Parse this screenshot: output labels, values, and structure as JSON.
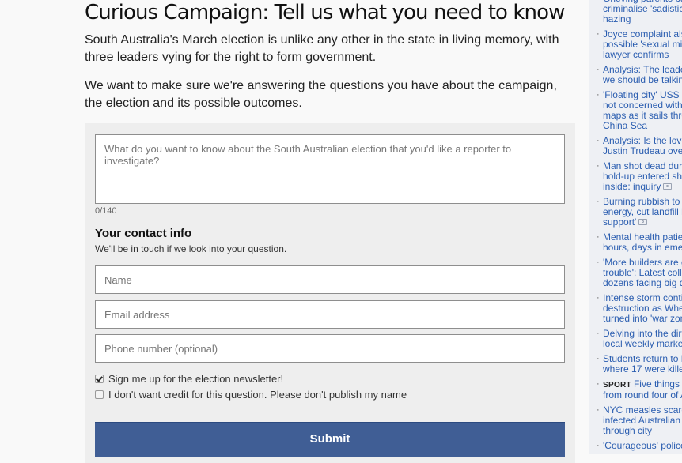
{
  "article": {
    "title": "Curious Campaign: Tell us what you need to know",
    "paragraphs": [
      "South Australia's March election is unlike any other in the state in living memory, with three leaders vying for the right to form government.",
      "We want to make sure we're answering the questions you have about the campaign, the election and its possible outcomes."
    ]
  },
  "form": {
    "question_placeholder": "What do you want to know about the South Australian election that you'd like a reporter to investigate?",
    "question_value": "",
    "char_counter": "0/140",
    "contact_title": "Your contact info",
    "contact_subtitle": "We'll be in touch if we look into your question.",
    "name_placeholder": "Name",
    "email_placeholder": "Email address",
    "phone_placeholder": "Phone number (optional)",
    "newsletter_label": "Sign me up for the election newsletter!",
    "newsletter_checked": true,
    "anonymous_label": "I don't want credit for this question. Please don't publish my name",
    "anonymous_checked": false,
    "submit_label": "Submit",
    "submit_color": "#405e95"
  },
  "sidebar": {
    "link_color": "#2a5db0",
    "items": [
      {
        "lines": [
          "Grieving parents back",
          "criminalise 'sadistic'",
          "hazing"
        ],
        "tag": "",
        "camera": false
      },
      {
        "lines": [
          "Joyce complaint also",
          "possible 'sexual mis",
          "lawyer confirms"
        ],
        "tag": "",
        "camera": false
      },
      {
        "lines": [
          "Analysis: The leade",
          "we should be talking"
        ],
        "tag": "",
        "camera": false
      },
      {
        "lines": [
          "'Floating city' USS C",
          "not concerned with",
          "maps as it sails thro",
          "China Sea"
        ],
        "tag": "",
        "camera": false
      },
      {
        "lines": [
          "Analysis: Is the love",
          "Justin Trudeau over"
        ],
        "tag": "",
        "camera": false
      },
      {
        "lines": [
          "Man shot dead durin",
          "hold-up entered sho",
          "inside: inquiry"
        ],
        "tag": "",
        "camera": true
      },
      {
        "lines": [
          "Burning rubbish to g",
          "energy, cut landfill h",
          "support'"
        ],
        "tag": "",
        "camera": true
      },
      {
        "lines": [
          "Mental health patien",
          "hours, days in emer"
        ],
        "tag": "",
        "camera": false
      },
      {
        "lines": [
          "'More builders are g",
          "trouble': Latest colla",
          "dozens facing big d"
        ],
        "tag": "",
        "camera": false
      },
      {
        "lines": [
          "Intense storm contin",
          "destruction as Whea",
          "turned into 'war zon"
        ],
        "tag": "",
        "camera": false
      },
      {
        "lines": [
          "Delving into the dirt",
          "local weekly market"
        ],
        "tag": "",
        "camera": false
      },
      {
        "lines": [
          "Students return to F",
          "where 17 were kille"
        ],
        "tag": "",
        "camera": false
      },
      {
        "lines": [
          "Five things w",
          "from round four of A"
        ],
        "tag": "SPORT",
        "camera": false
      },
      {
        "lines": [
          "NYC measles scare",
          "infected Australian t",
          "through city"
        ],
        "tag": "",
        "camera": false
      },
      {
        "lines": [
          "'Courageous' police"
        ],
        "tag": "",
        "camera": false
      }
    ]
  }
}
